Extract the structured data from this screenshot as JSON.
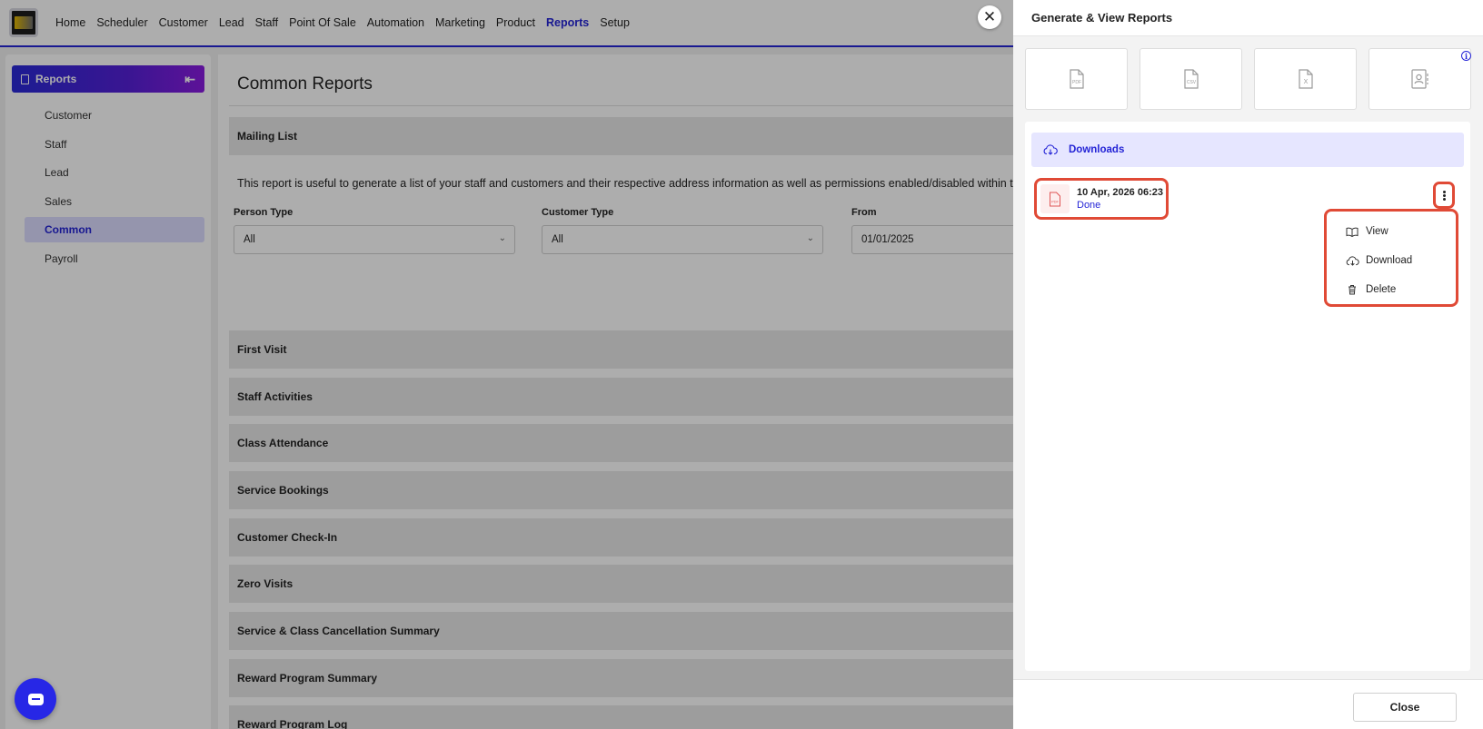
{
  "nav": {
    "items": [
      "Home",
      "Scheduler",
      "Customer",
      "Lead",
      "Staff",
      "Point Of Sale",
      "Automation",
      "Marketing",
      "Product",
      "Reports",
      "Setup"
    ],
    "active": "Reports"
  },
  "sidebar": {
    "title": "Reports",
    "items": [
      {
        "label": "Customer"
      },
      {
        "label": "Staff"
      },
      {
        "label": "Lead"
      },
      {
        "label": "Sales"
      },
      {
        "label": "Common",
        "active": true
      },
      {
        "label": "Payroll"
      }
    ]
  },
  "main": {
    "title": "Common Reports",
    "expanded_section": "Mailing List",
    "description": "This report is useful to generate a list of your staff and customers and their respective address information as well as permissions enabled/disabled within the",
    "filters": {
      "person_type": {
        "label": "Person Type",
        "value": "All"
      },
      "customer_type": {
        "label": "Customer Type",
        "value": "All"
      },
      "from": {
        "label": "From",
        "value": "01/01/2025"
      }
    },
    "sections": [
      "First Visit",
      "Staff Activities",
      "Class Attendance",
      "Service Bookings",
      "Customer Check-In",
      "Zero Visits",
      "Service & Class Cancellation Summary",
      "Reward Program Summary",
      "Reward Program Log"
    ]
  },
  "panel": {
    "title": "Generate & View Reports",
    "formats": [
      "PDF",
      "CSV",
      "X"
    ],
    "downloads_label": "Downloads",
    "file": {
      "date": "10 Apr, 2026 06:23",
      "status": "Done"
    },
    "menu": [
      "View",
      "Download",
      "Delete"
    ],
    "close_label": "Close"
  },
  "colors": {
    "accent": "#2424d6",
    "highlight": "#e04a36",
    "overlay": "rgba(0,0,0,0.32)"
  }
}
